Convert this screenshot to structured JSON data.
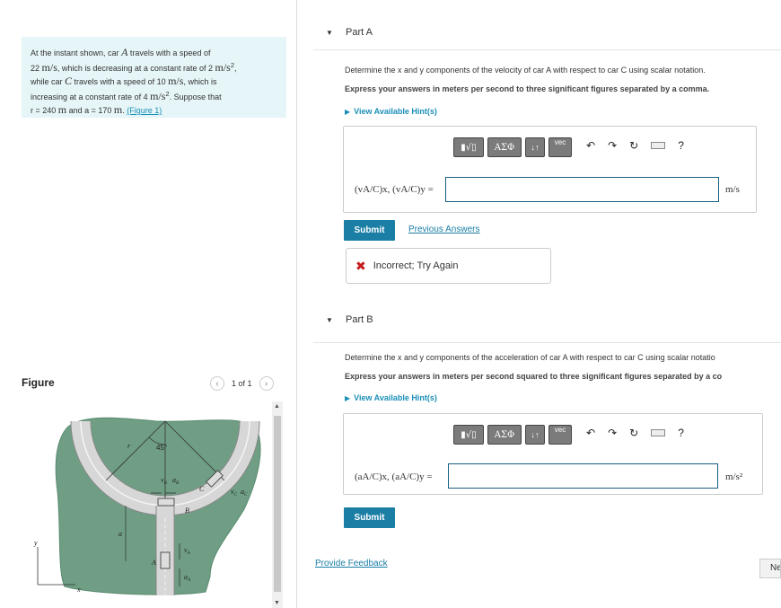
{
  "problem": {
    "line1": "At the instant shown, car ",
    "car_a": "A",
    "line2": " travels with a speed of",
    "speed_a": "22",
    "unit_ms": "m/s",
    "line3": ", which is decreasing at a constant rate of 2 ",
    "unit_ms2": "m/s",
    "line4": "while car ",
    "car_c": "C",
    "line5": " travels with a speed of 10 ",
    "line6": ", which is",
    "line7": "increasing at a constant rate of 4 ",
    "line8": ". Suppose that",
    "r_eq": "r = 240 ",
    "unit_m": "m",
    "a_eq": " and a = 170 ",
    "period": ".",
    "figure_link": "(Figure 1)"
  },
  "figure": {
    "title": "Figure",
    "pager": "1 of 1",
    "labels": {
      "angle": "45°",
      "r": "r",
      "vb": "v",
      "ab": "a",
      "sub_b": "B",
      "b": "B",
      "c": "C",
      "vc": "v",
      "ac": "a",
      "sub_c": "C",
      "va": "v",
      "aa": "a",
      "sub_a": "A",
      "a_pt": "A",
      "a_dist": "a",
      "x": "x",
      "y": "y"
    }
  },
  "partA": {
    "label": "Part A",
    "q1": "Determine the x and y components of the velocity of car A with respect to car C using scalar notation.",
    "q2": "Express your answers in meters per second to three significant figures separated by a comma.",
    "hint": "View Available Hint(s)",
    "eq": "(vA/C)x, (vA/C)y =",
    "unit": "m/s",
    "submit": "Submit",
    "prev": "Previous Answers",
    "feedback": "Incorrect; Try Again"
  },
  "partB": {
    "label": "Part B",
    "q1": "Determine the x and y components of the acceleration of car A with respect to car C using scalar notatio",
    "q2": "Express your answers in meters per second squared to three significant figures separated by a co",
    "hint": "View Available Hint(s)",
    "eq": "(aA/C)x, (aA/C)y =",
    "unit": "m/s²",
    "submit": "Submit"
  },
  "toolbar": {
    "templates": "▮√▯",
    "greek": "ΑΣΦ",
    "arrows": "↓↑",
    "vec": "vec",
    "help": "?"
  },
  "footer": {
    "feedback": "Provide Feedback",
    "next": "Next"
  },
  "colors": {
    "accent": "#1a7ea5",
    "panel": "#e6f5f7",
    "error": "#c81c1c",
    "ground": "#6f9e84"
  }
}
